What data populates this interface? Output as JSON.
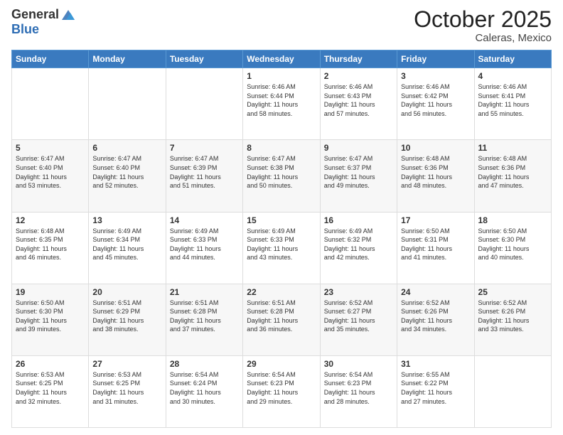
{
  "header": {
    "logo_general": "General",
    "logo_blue": "Blue",
    "month": "October 2025",
    "location": "Caleras, Mexico"
  },
  "days_of_week": [
    "Sunday",
    "Monday",
    "Tuesday",
    "Wednesday",
    "Thursday",
    "Friday",
    "Saturday"
  ],
  "weeks": [
    [
      {
        "day": "",
        "info": ""
      },
      {
        "day": "",
        "info": ""
      },
      {
        "day": "",
        "info": ""
      },
      {
        "day": "1",
        "info": "Sunrise: 6:46 AM\nSunset: 6:44 PM\nDaylight: 11 hours\nand 58 minutes."
      },
      {
        "day": "2",
        "info": "Sunrise: 6:46 AM\nSunset: 6:43 PM\nDaylight: 11 hours\nand 57 minutes."
      },
      {
        "day": "3",
        "info": "Sunrise: 6:46 AM\nSunset: 6:42 PM\nDaylight: 11 hours\nand 56 minutes."
      },
      {
        "day": "4",
        "info": "Sunrise: 6:46 AM\nSunset: 6:41 PM\nDaylight: 11 hours\nand 55 minutes."
      }
    ],
    [
      {
        "day": "5",
        "info": "Sunrise: 6:47 AM\nSunset: 6:40 PM\nDaylight: 11 hours\nand 53 minutes."
      },
      {
        "day": "6",
        "info": "Sunrise: 6:47 AM\nSunset: 6:40 PM\nDaylight: 11 hours\nand 52 minutes."
      },
      {
        "day": "7",
        "info": "Sunrise: 6:47 AM\nSunset: 6:39 PM\nDaylight: 11 hours\nand 51 minutes."
      },
      {
        "day": "8",
        "info": "Sunrise: 6:47 AM\nSunset: 6:38 PM\nDaylight: 11 hours\nand 50 minutes."
      },
      {
        "day": "9",
        "info": "Sunrise: 6:47 AM\nSunset: 6:37 PM\nDaylight: 11 hours\nand 49 minutes."
      },
      {
        "day": "10",
        "info": "Sunrise: 6:48 AM\nSunset: 6:36 PM\nDaylight: 11 hours\nand 48 minutes."
      },
      {
        "day": "11",
        "info": "Sunrise: 6:48 AM\nSunset: 6:36 PM\nDaylight: 11 hours\nand 47 minutes."
      }
    ],
    [
      {
        "day": "12",
        "info": "Sunrise: 6:48 AM\nSunset: 6:35 PM\nDaylight: 11 hours\nand 46 minutes."
      },
      {
        "day": "13",
        "info": "Sunrise: 6:49 AM\nSunset: 6:34 PM\nDaylight: 11 hours\nand 45 minutes."
      },
      {
        "day": "14",
        "info": "Sunrise: 6:49 AM\nSunset: 6:33 PM\nDaylight: 11 hours\nand 44 minutes."
      },
      {
        "day": "15",
        "info": "Sunrise: 6:49 AM\nSunset: 6:33 PM\nDaylight: 11 hours\nand 43 minutes."
      },
      {
        "day": "16",
        "info": "Sunrise: 6:49 AM\nSunset: 6:32 PM\nDaylight: 11 hours\nand 42 minutes."
      },
      {
        "day": "17",
        "info": "Sunrise: 6:50 AM\nSunset: 6:31 PM\nDaylight: 11 hours\nand 41 minutes."
      },
      {
        "day": "18",
        "info": "Sunrise: 6:50 AM\nSunset: 6:30 PM\nDaylight: 11 hours\nand 40 minutes."
      }
    ],
    [
      {
        "day": "19",
        "info": "Sunrise: 6:50 AM\nSunset: 6:30 PM\nDaylight: 11 hours\nand 39 minutes."
      },
      {
        "day": "20",
        "info": "Sunrise: 6:51 AM\nSunset: 6:29 PM\nDaylight: 11 hours\nand 38 minutes."
      },
      {
        "day": "21",
        "info": "Sunrise: 6:51 AM\nSunset: 6:28 PM\nDaylight: 11 hours\nand 37 minutes."
      },
      {
        "day": "22",
        "info": "Sunrise: 6:51 AM\nSunset: 6:28 PM\nDaylight: 11 hours\nand 36 minutes."
      },
      {
        "day": "23",
        "info": "Sunrise: 6:52 AM\nSunset: 6:27 PM\nDaylight: 11 hours\nand 35 minutes."
      },
      {
        "day": "24",
        "info": "Sunrise: 6:52 AM\nSunset: 6:26 PM\nDaylight: 11 hours\nand 34 minutes."
      },
      {
        "day": "25",
        "info": "Sunrise: 6:52 AM\nSunset: 6:26 PM\nDaylight: 11 hours\nand 33 minutes."
      }
    ],
    [
      {
        "day": "26",
        "info": "Sunrise: 6:53 AM\nSunset: 6:25 PM\nDaylight: 11 hours\nand 32 minutes."
      },
      {
        "day": "27",
        "info": "Sunrise: 6:53 AM\nSunset: 6:25 PM\nDaylight: 11 hours\nand 31 minutes."
      },
      {
        "day": "28",
        "info": "Sunrise: 6:54 AM\nSunset: 6:24 PM\nDaylight: 11 hours\nand 30 minutes."
      },
      {
        "day": "29",
        "info": "Sunrise: 6:54 AM\nSunset: 6:23 PM\nDaylight: 11 hours\nand 29 minutes."
      },
      {
        "day": "30",
        "info": "Sunrise: 6:54 AM\nSunset: 6:23 PM\nDaylight: 11 hours\nand 28 minutes."
      },
      {
        "day": "31",
        "info": "Sunrise: 6:55 AM\nSunset: 6:22 PM\nDaylight: 11 hours\nand 27 minutes."
      },
      {
        "day": "",
        "info": ""
      }
    ]
  ]
}
